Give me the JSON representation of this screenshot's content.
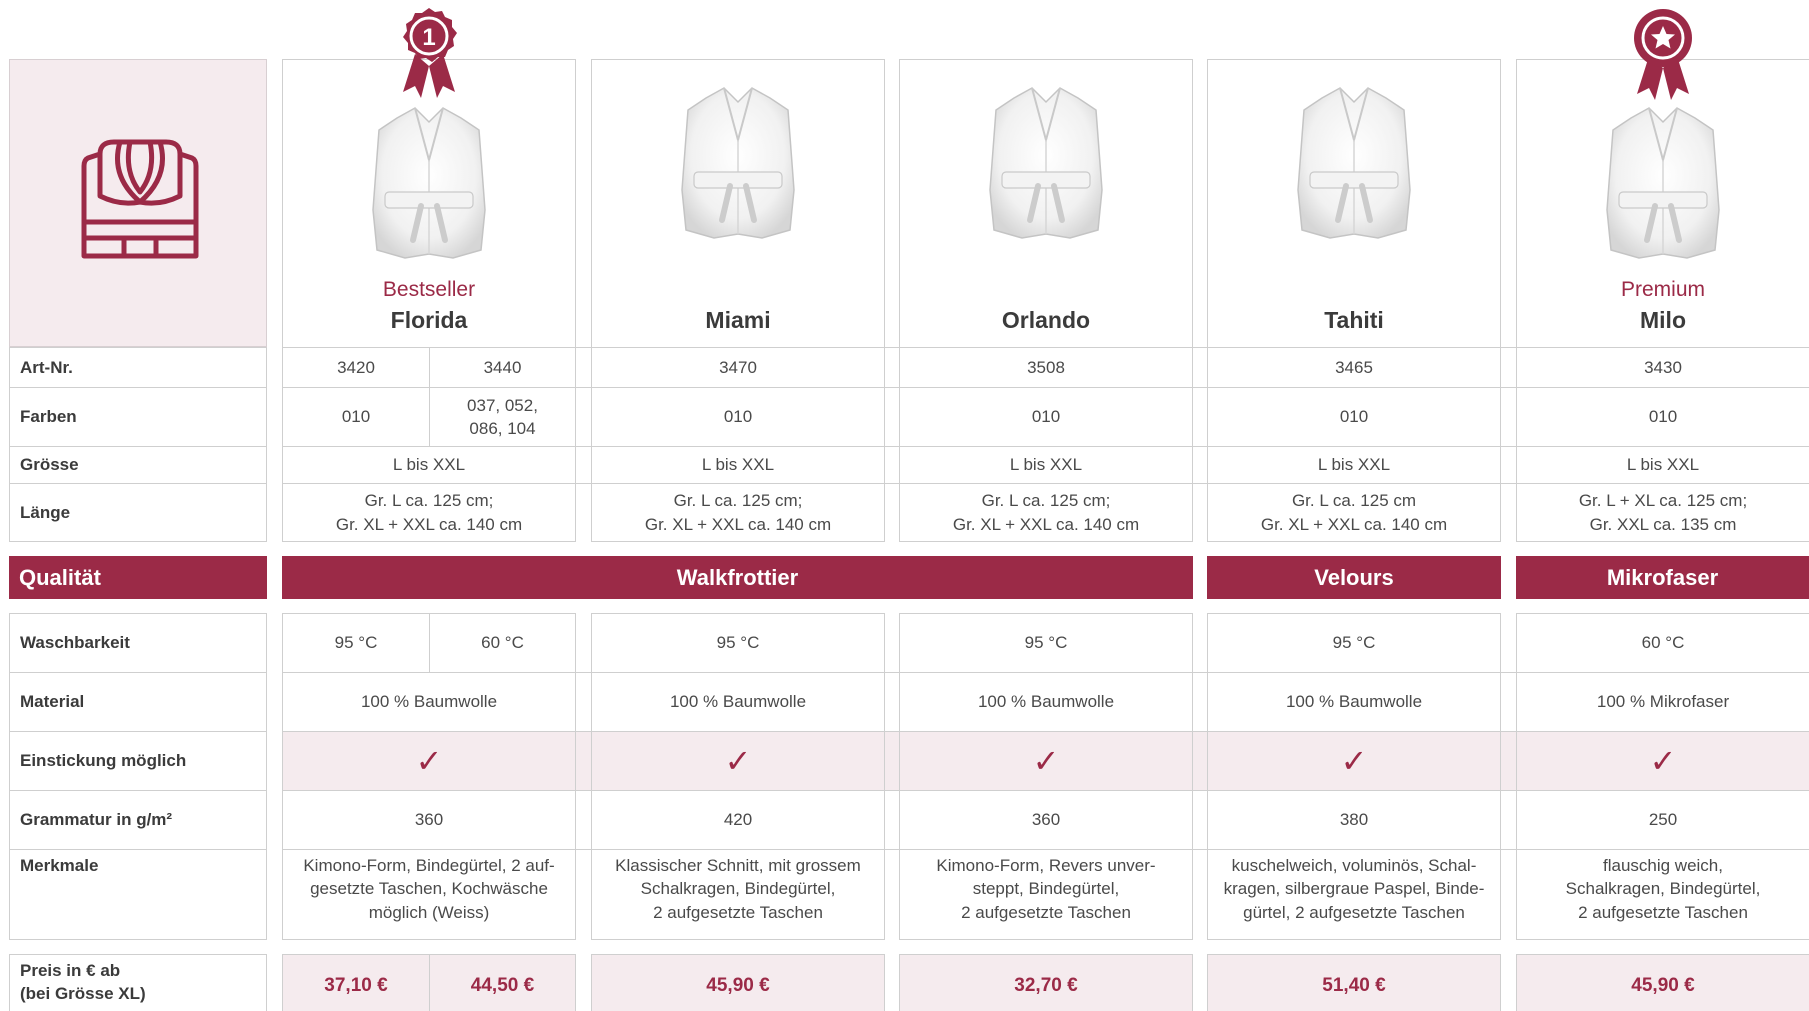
{
  "products": [
    {
      "tag": "Bestseller",
      "name": "Florida",
      "medal": "number-1-ribbon-icon",
      "medal_text": "1"
    },
    {
      "tag": "",
      "name": "Miami"
    },
    {
      "tag": "",
      "name": "Orlando"
    },
    {
      "tag": "",
      "name": "Tahiti"
    },
    {
      "tag": "Premium",
      "name": "Milo",
      "medal": "star-ribbon-icon"
    }
  ],
  "header_icon": "bathrobe-icon",
  "labels": {
    "art_nr": "Art-Nr.",
    "farben": "Farben",
    "groesse": "Grösse",
    "laenge": "Länge",
    "qualitaet": "Qualität",
    "waschbarkeit": "Waschbarkeit",
    "material": "Material",
    "einstickung": "Einstickung möglich",
    "grammatur": "Grammatur in g/m²",
    "merkmale": "Merkmale",
    "preis_1": "Preis in € ab",
    "preis_2": "(bei Grösse XL)"
  },
  "florida": {
    "art_a": "3420",
    "art_b": "3440",
    "farbe_a": "010",
    "farbe_b_1": "037, 052,",
    "farbe_b_2": "086, 104",
    "groesse": "L bis XXL",
    "laenge_1": "Gr. L ca. 125 cm;",
    "laenge_2": "Gr. XL + XXL ca. 140 cm",
    "wasch_a": "95 °C",
    "wasch_b": "60 °C",
    "material": "100 % Baumwolle",
    "check": "✓",
    "grammatur": "360",
    "merk_1": "Kimono-Form, Bindegürtel, 2 auf-",
    "merk_2": "gesetzte Taschen, Kochwäsche",
    "merk_3": "möglich (Weiss)",
    "preis_a": "37,10 €",
    "preis_b": "44,50 €"
  },
  "miami": {
    "art": "3470",
    "farbe": "010",
    "groesse": "L bis XXL",
    "laenge_1": "Gr. L ca. 125 cm;",
    "laenge_2": "Gr. XL + XXL ca. 140 cm",
    "wasch": "95 °C",
    "material": "100 % Baumwolle",
    "check": "✓",
    "grammatur": "420",
    "merk_1": "Klassischer Schnitt, mit grossem",
    "merk_2": "Schalkragen, Bindegürtel,",
    "merk_3": "2 aufgesetzte Taschen",
    "preis": "45,90 €"
  },
  "orlando": {
    "art": "3508",
    "farbe": "010",
    "groesse": "L bis XXL",
    "laenge_1": "Gr. L ca. 125 cm;",
    "laenge_2": "Gr. XL + XXL ca. 140 cm",
    "wasch": "95 °C",
    "material": "100 % Baumwolle",
    "check": "✓",
    "grammatur": "360",
    "merk_1": "Kimono-Form, Revers unver-",
    "merk_2": "steppt, Bindegürtel,",
    "merk_3": "2 aufgesetzte Taschen",
    "preis": "32,70 €"
  },
  "tahiti": {
    "art": "3465",
    "farbe": "010",
    "groesse": "L bis XXL",
    "laenge_1": "Gr. L ca. 125 cm",
    "laenge_2": "Gr. XL + XXL ca. 140 cm",
    "wasch": "95 °C",
    "material": "100 % Baumwolle",
    "check": "✓",
    "grammatur": "380",
    "merk_1": "kuschelweich, voluminös, Schal-",
    "merk_2": "kragen, silbergraue Paspel, Binde-",
    "merk_3": "gürtel, 2 aufgesetzte Taschen",
    "preis": "51,40 €"
  },
  "milo": {
    "art": "3430",
    "farbe": "010",
    "groesse": "L bis XXL",
    "laenge_1": "Gr. L + XL ca. 125 cm;",
    "laenge_2": "Gr. XXL ca. 135 cm",
    "wasch": "60 °C",
    "material": "100 % Mikrofaser",
    "check": "✓",
    "grammatur": "250",
    "merk_1": "flauschig weich,",
    "merk_2": "Schalkragen, Bindegürtel,",
    "merk_3": "2 aufgesetzte Taschen",
    "preis": "45,90 €"
  },
  "quality": {
    "walkfrottier": "Walkfrottier",
    "velours": "Velours",
    "mikrofaser": "Mikrofaser"
  },
  "colors": {
    "accent": "#9b2a47",
    "pink_bg": "#f5ebee",
    "border": "#cfcfcf"
  }
}
